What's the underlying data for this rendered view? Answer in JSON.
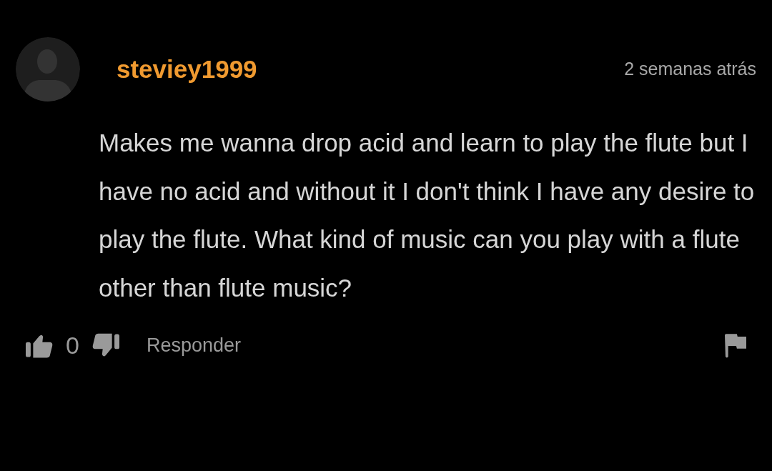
{
  "comment": {
    "username": "steviey1999",
    "time": "2 semanas atrás",
    "text": "Makes me wanna drop acid and learn to play the flute but I have no acid and without it I don't think I have any desire to play the flute. What kind of music can you play with a flute other than flute music?",
    "likes": "0",
    "reply": "Responder"
  }
}
